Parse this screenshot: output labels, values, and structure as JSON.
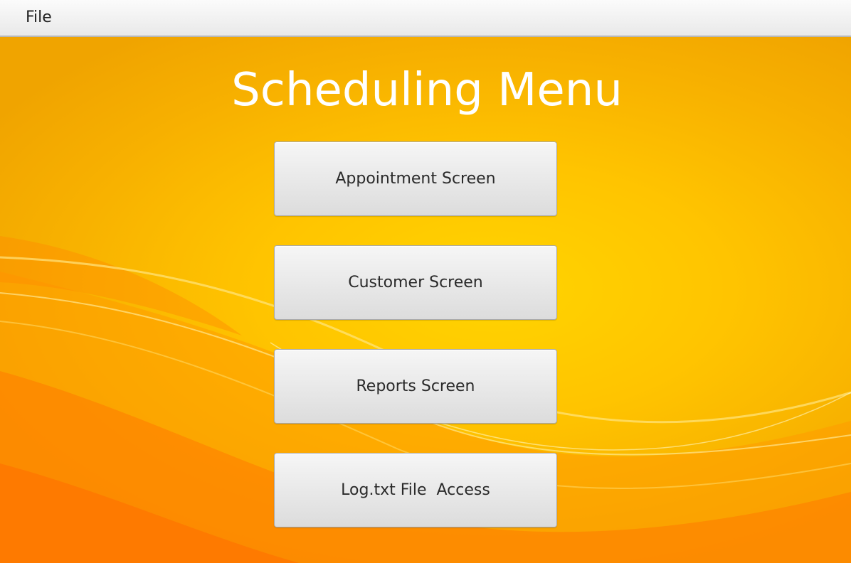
{
  "menubar": {
    "items": [
      {
        "label": "File"
      }
    ]
  },
  "main": {
    "title": "Scheduling Menu",
    "buttons": [
      {
        "label": "Appointment Screen"
      },
      {
        "label": "Customer Screen"
      },
      {
        "label": "Reports Screen"
      },
      {
        "label": "Log.txt File  Access"
      }
    ]
  },
  "colors": {
    "background_primary": "#ffc400",
    "background_accent": "#ff8a00",
    "title_text": "#ffffff",
    "button_face": "#e8e8e8",
    "button_text": "#2a2a2a"
  }
}
